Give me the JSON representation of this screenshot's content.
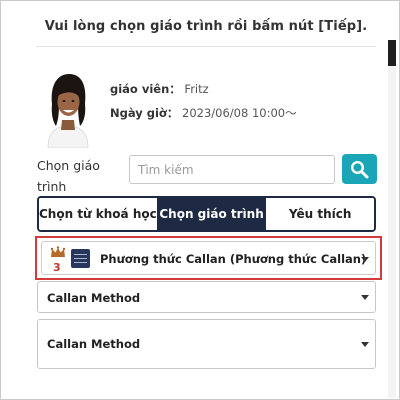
{
  "header": {
    "title": "Vui lòng chọn giáo trình rồi bấm nút [Tiếp]."
  },
  "teacher": {
    "avatar": "teacher-photo",
    "label": "giáo viên：",
    "name": "Fritz",
    "datetime_label": "Ngày giờ：",
    "datetime": "2023/06/08 10:00～"
  },
  "search": {
    "label": "Chọn giáo trình",
    "placeholder": "Tìm kiếm",
    "button_icon": "search-icon"
  },
  "tabs": [
    {
      "label": "Chọn từ khoá học",
      "active": false
    },
    {
      "label": "Chọn giáo trình",
      "active": true
    },
    {
      "label": "Yêu thích",
      "active": false
    }
  ],
  "course_select": {
    "rank_icon": "crown-icon",
    "rank": "3",
    "logo_icon": "course-logo-icon",
    "value": "Phương thức Callan (Phương thức Callan)"
  },
  "dropdowns": [
    {
      "value": "Callan Method"
    },
    {
      "value": "Callan Method"
    }
  ],
  "colors": {
    "accent_teal": "#1aa6b7",
    "tab_active": "#1e2a44",
    "highlight_red": "#d23b3b",
    "rank_orange": "#c0392b"
  }
}
